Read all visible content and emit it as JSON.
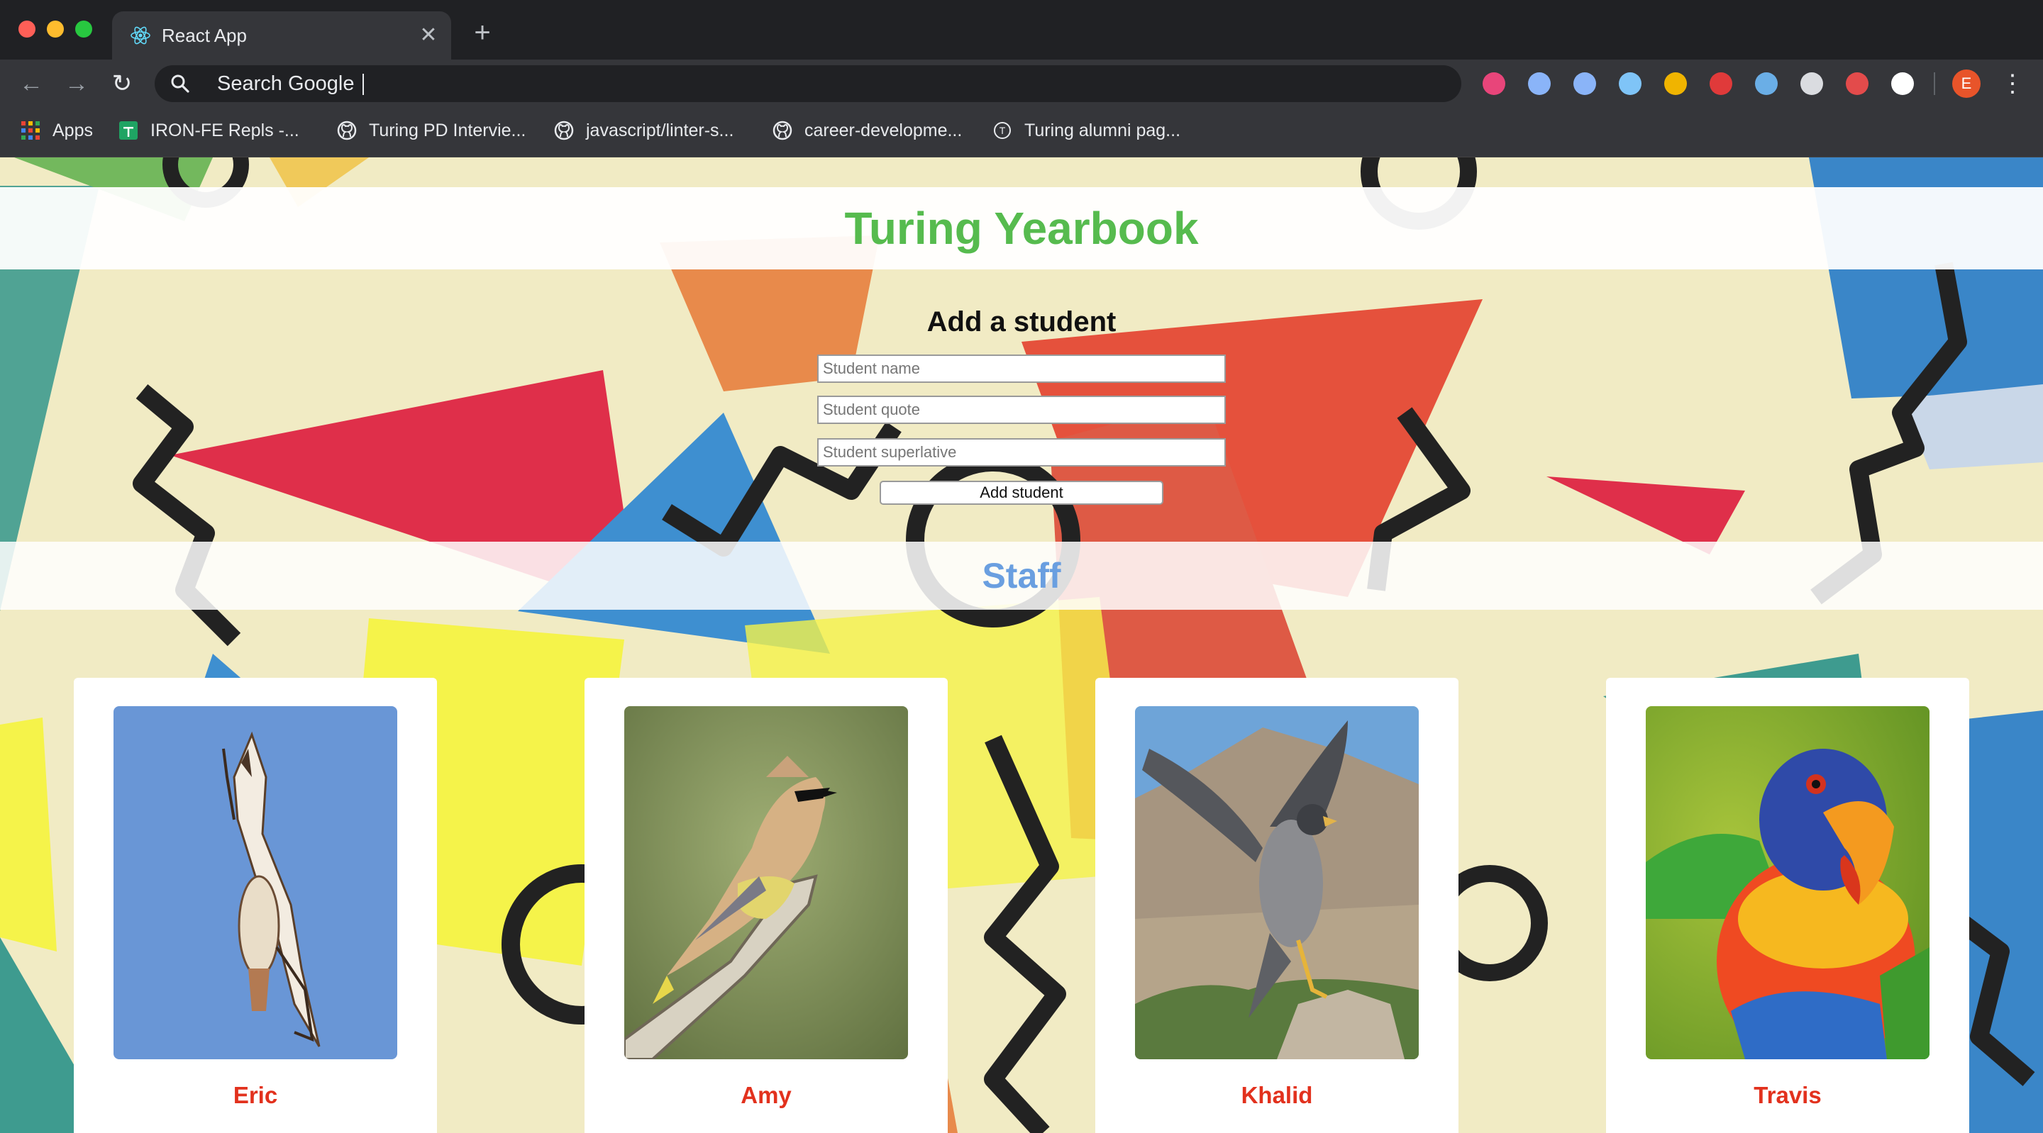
{
  "browser": {
    "tab_title": "React App",
    "tab_close": "✕",
    "new_tab": "+",
    "omnibox_text": "Search Google",
    "profile_initial": "E",
    "menu_dots": "⋮",
    "nav": {
      "back": "←",
      "forward": "→",
      "reload": "↻"
    },
    "bookmarks": [
      {
        "label": "Apps",
        "icon": "apps-grid-icon"
      },
      {
        "label": "IRON-FE Repls -...",
        "icon": "sheets-icon"
      },
      {
        "label": "Turing PD Intervie...",
        "icon": "github-icon"
      },
      {
        "label": "javascript/linter-s...",
        "icon": "github-icon"
      },
      {
        "label": "career-developme...",
        "icon": "github-icon"
      },
      {
        "label": "Turing alumni pag...",
        "icon": "turing-icon"
      }
    ],
    "extensions": [
      {
        "icon": "ext-pink-icon",
        "color": "#e8457a"
      },
      {
        "icon": "ext-blue-square-icon",
        "color": "#8ab4f8"
      },
      {
        "icon": "ext-eyedropper-icon",
        "color": "#8ab4f8"
      },
      {
        "icon": "ext-marker-icon",
        "color": "#7fc4f7"
      },
      {
        "icon": "ext-colorwheel-icon",
        "color": "#f0b400"
      },
      {
        "icon": "ext-hand-icon",
        "color": "#e03a3a"
      },
      {
        "icon": "ext-blue-circle-icon",
        "color": "#6aaee6"
      },
      {
        "icon": "ext-target-icon",
        "color": "#dadce0"
      },
      {
        "icon": "ext-red-puzzle-icon",
        "color": "#e34b4b"
      },
      {
        "icon": "ext-json-icon",
        "color": "#ffffff"
      }
    ]
  },
  "page": {
    "title": "Turing Yearbook",
    "form": {
      "heading": "Add a student",
      "name_placeholder": "Student name",
      "quote_placeholder": "Student quote",
      "superlative_placeholder": "Student superlative",
      "submit_label": "Add student"
    },
    "staff_heading": "Staff",
    "staff": [
      {
        "name": "Eric",
        "photo": "hawk-photo"
      },
      {
        "name": "Amy",
        "photo": "cedar-waxwing-photo"
      },
      {
        "name": "Khalid",
        "photo": "falcon-photo"
      },
      {
        "name": "Travis",
        "photo": "lorikeet-photo"
      }
    ]
  },
  "colors": {
    "title_green": "#56bb4e",
    "staff_blue": "#6a9fe0",
    "name_red": "#e2311d"
  }
}
